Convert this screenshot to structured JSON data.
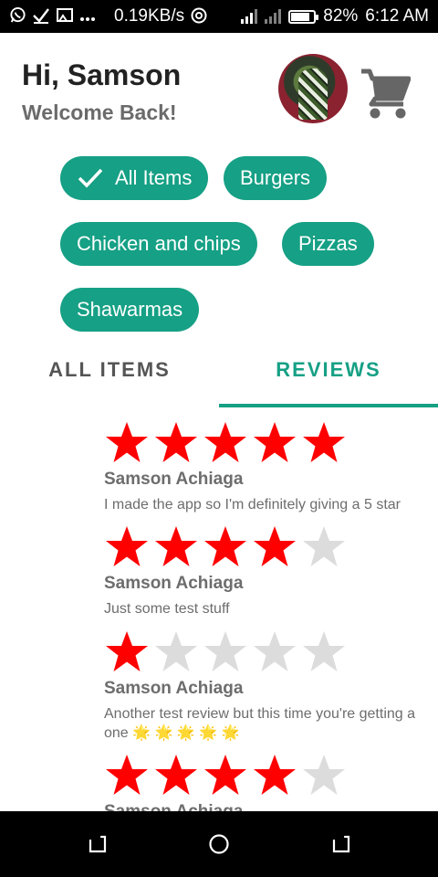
{
  "status_bar": {
    "speed": "0.19KB/s",
    "battery_percent": "82%",
    "battery_level": 0.82,
    "time": "6:12 AM",
    "left_icons": [
      "whatsapp-icon",
      "check-icon",
      "cast-icon",
      "more-dots-icon"
    ]
  },
  "header": {
    "greeting": "Hi, Samson",
    "subtitle": "Welcome Back!"
  },
  "categories": [
    {
      "label": "All Items",
      "selected": true
    },
    {
      "label": "Burgers",
      "selected": false
    },
    {
      "label": "Chicken and chips",
      "selected": false
    },
    {
      "label": "Pizzas",
      "selected": false
    },
    {
      "label": "Shawarmas",
      "selected": false
    }
  ],
  "tabs": [
    {
      "label": "ALL ITEMS",
      "active": false
    },
    {
      "label": "REVIEWS",
      "active": true
    }
  ],
  "reviews": [
    {
      "rating": 5,
      "name": "Samson Achiaga",
      "text": "I made the app so I'm definitely giving a 5 star"
    },
    {
      "rating": 4,
      "name": "Samson Achiaga",
      "text": "Just some test stuff"
    },
    {
      "rating": 1,
      "name": "Samson Achiaga",
      "text": "Another test review but this time you're getting a one 🌟 🌟 🌟 🌟 🌟"
    },
    {
      "rating": 4,
      "name": "Samson Achiaga",
      "text": ""
    }
  ],
  "colors": {
    "accent": "#16a085",
    "star_filled": "#ff0000",
    "star_empty": "#dcdcdc"
  }
}
